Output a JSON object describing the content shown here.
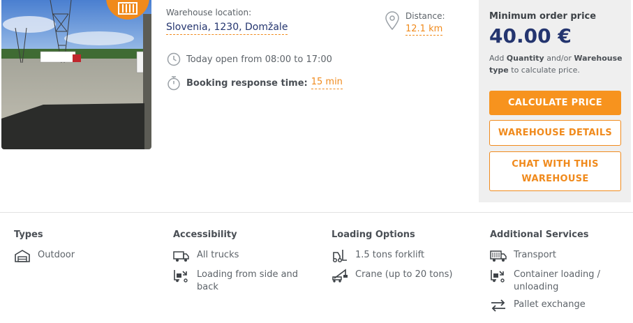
{
  "listing": {
    "location_label": "Warehouse location:",
    "location_value": "Slovenia, 1230, Domžale",
    "opening_hours": "Today open from 08:00 to 17:00",
    "response_label": "Booking response time:",
    "response_value": "15 min",
    "distance_label": "Distance:",
    "distance_value": "12.1 km"
  },
  "pricing": {
    "min_order_label": "Minimum order price",
    "min_order_value": "40.00 €",
    "hint_prefix": "Add",
    "hint_quantity": "Quantity",
    "hint_middle": "and/or",
    "hint_type": "Warehouse type",
    "hint_suffix": "to calculate price.",
    "calculate_button": "CALCULATE PRICE",
    "details_button": "WAREHOUSE DETAILS",
    "chat_button": "CHAT WITH THIS WAREHOUSE"
  },
  "features": {
    "types": {
      "title": "Types",
      "items": [
        {
          "label": "Outdoor",
          "icon": "outdoor-warehouse-icon"
        }
      ]
    },
    "accessibility": {
      "title": "Accessibility",
      "items": [
        {
          "label": "All trucks",
          "icon": "truck-icon"
        },
        {
          "label": "Loading from side and back",
          "icon": "loading-icon"
        }
      ]
    },
    "loading": {
      "title": "Loading Options",
      "items": [
        {
          "label": "1.5 tons forklift",
          "icon": "forklift-icon"
        },
        {
          "label": "Crane (up to 20 tons)",
          "icon": "crane-icon"
        }
      ]
    },
    "services": {
      "title": "Additional Services",
      "items": [
        {
          "label": "Transport",
          "icon": "transport-truck-icon"
        },
        {
          "label": "Container loading / unloading",
          "icon": "container-loading-icon"
        },
        {
          "label": "Pallet exchange",
          "icon": "pallet-exchange-icon"
        }
      ]
    }
  },
  "colors": {
    "accent": "#f7931e",
    "navy": "#24356f",
    "panel": "#efefef"
  }
}
